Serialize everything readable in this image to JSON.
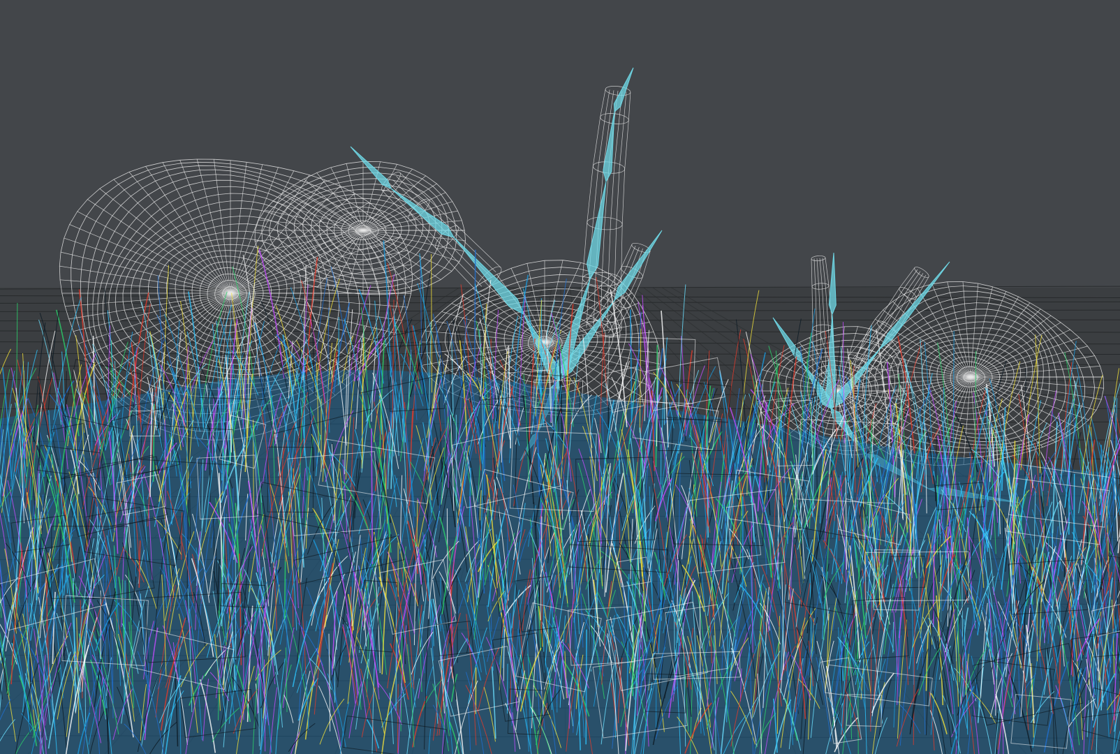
{
  "viewport": {
    "mode": "wireframe",
    "background": "#43464a",
    "floor_color": "#3b3e41",
    "wire_color": "#e8e8e8",
    "bone_color": "#6fd8e6",
    "fur_palette": [
      "#1f6fd1",
      "#2ec5ff",
      "#2ad36a",
      "#ffffff",
      "#c54bff",
      "#e23a2a",
      "#f3e13a",
      "#0c1a24",
      "#1a9be0",
      "#6ce0ff"
    ]
  },
  "scene": {
    "objects": [
      {
        "name": "snail-left",
        "type": "wireframe-mesh"
      },
      {
        "name": "snail-right",
        "type": "wireframe-mesh"
      },
      {
        "name": "bone-rig-left",
        "type": "bones"
      },
      {
        "name": "bone-rig-right",
        "type": "bones"
      },
      {
        "name": "grass-field",
        "type": "hair-guides"
      }
    ]
  }
}
